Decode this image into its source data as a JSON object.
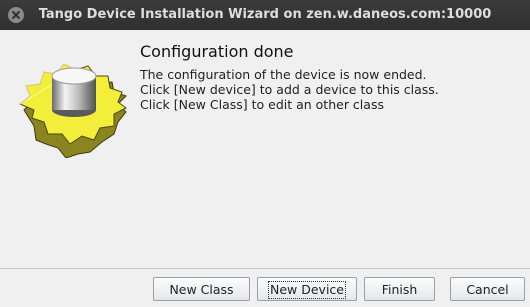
{
  "window": {
    "title": "Tango Device Installation Wizard on zen.w.daneos.com:10000"
  },
  "main": {
    "heading": "Configuration done",
    "lines": [
      "The configuration of the device is now ended.",
      "Click [New device] to add a device to this class.",
      "Click [New Class] to edit an other class"
    ],
    "icon": "yellow-gear-cylinder-icon"
  },
  "buttons": {
    "new_class": "New Class",
    "new_device": "New Device",
    "finish": "Finish",
    "cancel": "Cancel"
  },
  "colors": {
    "titlebar": "#3a3a3a",
    "gear": "#f2ee3a",
    "background": "#f0f0f0"
  }
}
